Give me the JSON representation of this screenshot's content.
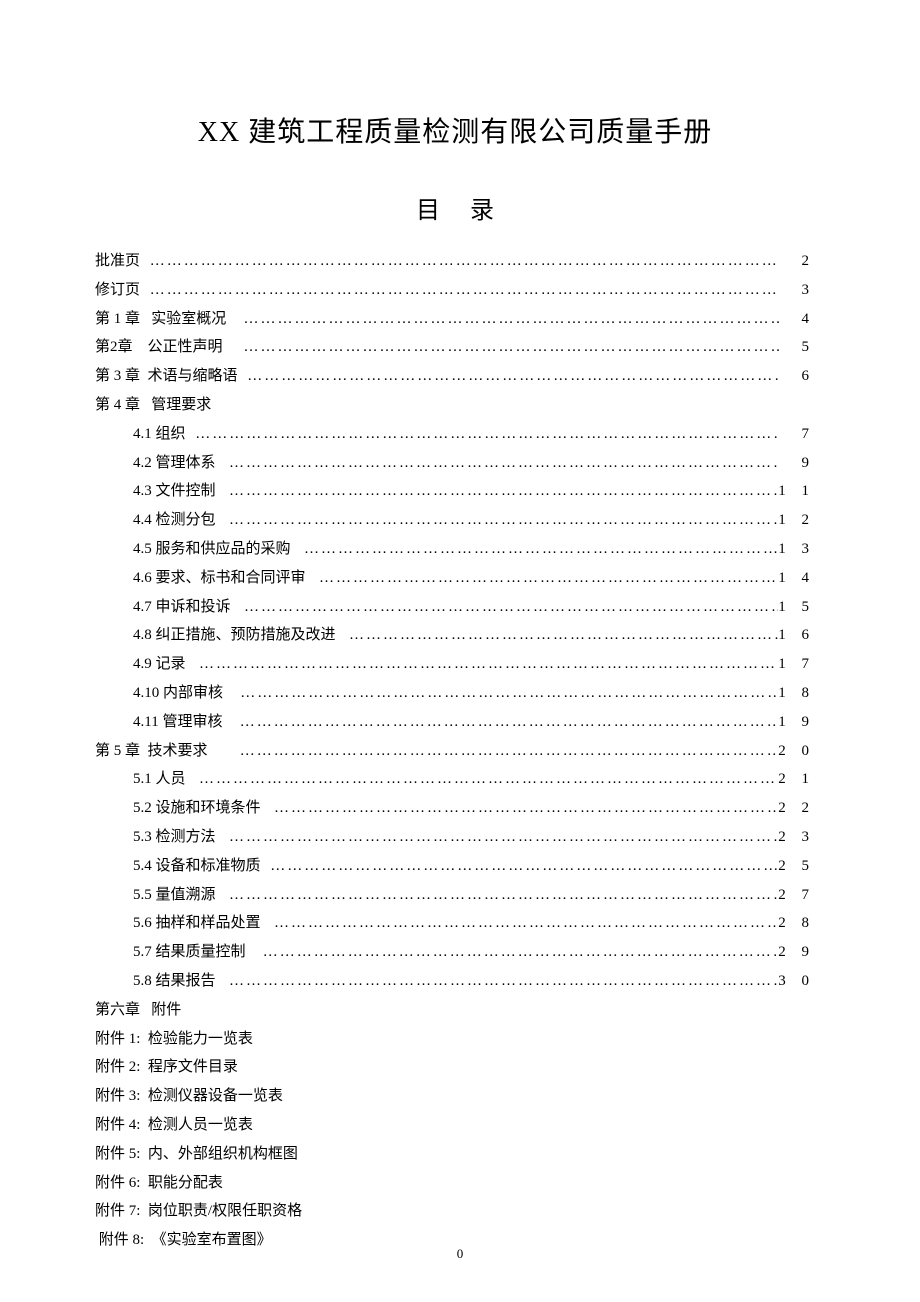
{
  "title": "XX 建筑工程质量检测有限公司质量手册",
  "subtitle": "目录",
  "entries": [
    {
      "label": "批准页 ",
      "page": "2",
      "indent": false,
      "dots": true
    },
    {
      "label": "修订页 ",
      "page": "3",
      "indent": false,
      "dots": true
    },
    {
      "label": "第 1 章   实验室概况   ",
      "page": "4",
      "indent": false,
      "dots": true
    },
    {
      "label": "第2章    公正性声明    ",
      "page": "5",
      "indent": false,
      "dots": true
    },
    {
      "label": "第 3 章  术语与缩略语 ",
      "page": "6",
      "indent": false,
      "dots": true
    },
    {
      "label": "第 4 章   管理要求",
      "page": "",
      "indent": false,
      "dots": false
    },
    {
      "label": "4.1 组织 ",
      "page": "7",
      "indent": true,
      "dots": true
    },
    {
      "label": "4.2 管理体系  ",
      "page": "9",
      "indent": true,
      "dots": true
    },
    {
      "label": "4.3 文件控制  ",
      "page": "1 1",
      "indent": true,
      "dots": true
    },
    {
      "label": "4.4 检测分包  ",
      "page": "1 2",
      "indent": true,
      "dots": true
    },
    {
      "label": "4.5 服务和供应品的采购  ",
      "page": "1 3",
      "indent": true,
      "dots": true
    },
    {
      "label": "4.6 要求、标书和合同评审  ",
      "page": "1 4",
      "indent": true,
      "dots": true
    },
    {
      "label": "4.7 申诉和投诉  ",
      "page": "1 5",
      "indent": true,
      "dots": true
    },
    {
      "label": "4.8 纠正措施、预防措施及改进  ",
      "page": "1 6",
      "indent": true,
      "dots": true
    },
    {
      "label": "4.9 记录  ",
      "page": "1 7",
      "indent": true,
      "dots": true
    },
    {
      "label": "4.10 内部审核   ",
      "page": "1 8",
      "indent": true,
      "dots": true
    },
    {
      "label": "4.11 管理审核   ",
      "page": "1 9",
      "indent": true,
      "dots": true
    },
    {
      "label": "第 5 章  技术要求       ",
      "page": "2 0",
      "indent": false,
      "dots": true
    },
    {
      "label": "5.1 人员  ",
      "page": "2 1",
      "indent": true,
      "dots": true
    },
    {
      "label": "5.2 设施和环境条件  ",
      "page": "2 2",
      "indent": true,
      "dots": true
    },
    {
      "label": "5.3 检测方法  ",
      "page": "2 3",
      "indent": true,
      "dots": true
    },
    {
      "label": "5.4 设备和标准物质 ",
      "page": "2 5",
      "indent": true,
      "dots": true
    },
    {
      "label": "5.5 量值溯源  ",
      "page": "2 7",
      "indent": true,
      "dots": true
    },
    {
      "label": "5.6 抽样和样品处置  ",
      "page": "2 8",
      "indent": true,
      "dots": true
    },
    {
      "label": "5.7 结果质量控制   ",
      "page": "2 9",
      "indent": true,
      "dots": true
    },
    {
      "label": "5.8 结果报告  ",
      "page": "3 0",
      "indent": true,
      "dots": true
    },
    {
      "label": "第六章   附件",
      "page": "",
      "indent": false,
      "dots": false
    }
  ],
  "appendices": [
    "附件 1:  检验能力一览表",
    "附件 2:  程序文件目录",
    "附件 3:  检测仪器设备一览表",
    "附件 4:  检测人员一览表",
    "附件 5:  内、外部组织机构框图",
    "附件 6:  职能分配表",
    "附件 7:  岗位职责/权限任职资格",
    " 附件 8:  《实验室布置图》"
  ],
  "footer": "0"
}
